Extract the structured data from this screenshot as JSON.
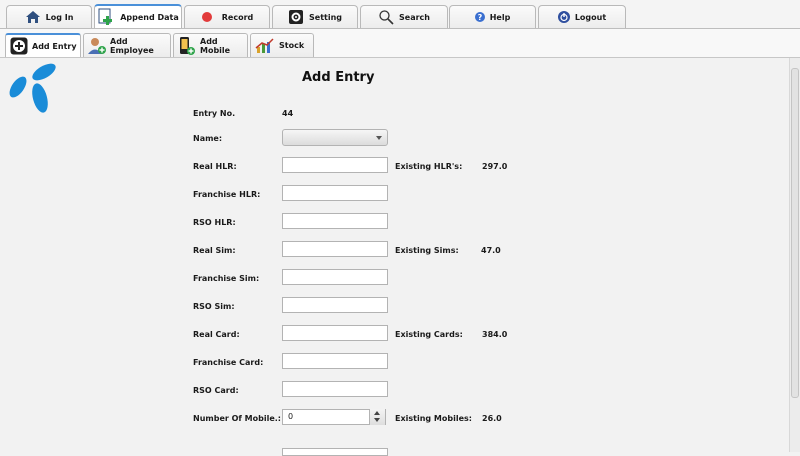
{
  "top_tabs": [
    {
      "label": "Log In",
      "icon": "home-icon"
    },
    {
      "label": "Append Data",
      "icon": "add-document-icon"
    },
    {
      "label": "Record",
      "icon": "record-icon"
    },
    {
      "label": "Setting",
      "icon": "settings-icon"
    },
    {
      "label": "Search",
      "icon": "search-icon"
    },
    {
      "label": "Help",
      "icon": "help-icon"
    },
    {
      "label": "Logout",
      "icon": "power-icon"
    }
  ],
  "sub_tabs": [
    {
      "label": "Add Entry",
      "icon": "plus-icon"
    },
    {
      "label": "Add Employee",
      "icon": "employee-icon"
    },
    {
      "label": "Add Mobile",
      "icon": "mobile-icon"
    },
    {
      "label": "Stock",
      "icon": "chart-icon"
    }
  ],
  "form": {
    "title": "Add Entry",
    "entry_no_label": "Entry No.",
    "entry_no_value": "44",
    "name_label": "Name:",
    "name_value": "",
    "fields": [
      {
        "label": "Real HLR:",
        "value": "",
        "existing_label": "Existing HLR's:",
        "existing_value": "297.0"
      },
      {
        "label": "Franchise HLR:",
        "value": ""
      },
      {
        "label": "RSO HLR:",
        "value": ""
      },
      {
        "label": "Real Sim:",
        "value": "",
        "existing_label": "Existing Sims:",
        "existing_value": "47.0"
      },
      {
        "label": "Franchise Sim:",
        "value": ""
      },
      {
        "label": "RSO Sim:",
        "value": ""
      },
      {
        "label": "Real Card:",
        "value": "",
        "existing_label": "Existing Cards:",
        "existing_value": "384.0"
      },
      {
        "label": "Franchise Card:",
        "value": ""
      },
      {
        "label": "RSO Card:",
        "value": ""
      }
    ],
    "mobile_label": "Number Of Mobile.:",
    "mobile_value": "0",
    "existing_mobiles_label": "Existing Mobiles:",
    "existing_mobiles_value": "26.0"
  },
  "colors": {
    "brand": "#1a8cd8",
    "active_tab_accent": "#4a90d9",
    "record": "#e23b3b"
  }
}
